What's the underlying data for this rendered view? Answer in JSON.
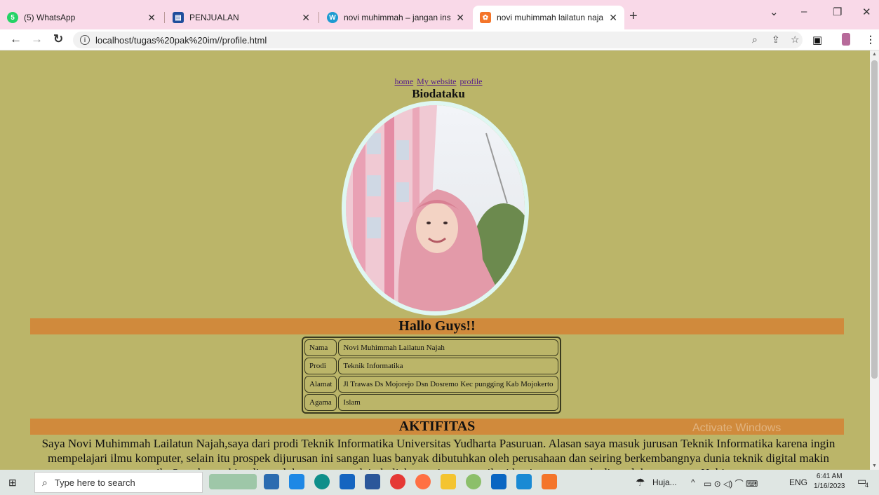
{
  "browser": {
    "tabs": [
      {
        "label": "(5) WhatsApp",
        "color": "#25d366",
        "glyph": "5"
      },
      {
        "label": "PENJUALAN",
        "color": "#1f4e9c",
        "glyph": "▤"
      },
      {
        "label": "novi muhimmah – jangan insecu",
        "color": "#1d9bd1",
        "glyph": "W"
      },
      {
        "label": "novi muhimmah lailatun najah",
        "color": "#f4752a",
        "glyph": "✿"
      }
    ],
    "address": "localhost/tugas%20pak%20im//profile.html"
  },
  "page": {
    "links": [
      "home",
      "My website",
      "profile"
    ],
    "heading": "Biodataku",
    "greeting": "Hallo Guys!!",
    "bio": [
      {
        "label": "Nama",
        "value": "Novi Muhimmah Lailatun Najah"
      },
      {
        "label": "Prodi",
        "value": "Teknik Informatika"
      },
      {
        "label": "Alamat",
        "value": "Jl Trawas Ds Mojorejo Dsn Dosremo Kec pungging Kab Mojokerto"
      },
      {
        "label": "Agama",
        "value": "Islam"
      }
    ],
    "activity_heading": "AKTIFITAS",
    "activity_text": "Saya Novi Muhimmah Lailatun Najah,saya dari prodi Teknik Informatika Universitas Yudharta Pasuruan. Alasan saya masuk jurusan Teknik Informatika karena ingin mempelajari ilmu komputer, selain itu prospek dijurusan ini sangan luas banyak dibutuhkan oleh perusahaan dan seiring berkembangnya dunia teknik digital makin canggih. Saya bermukim di pondok pesantren selain kuliah saya juga mengikuti kegiatan yang ada dipondok pesantren. Hobi saya",
    "watermark": "Activate Windows",
    "bg_color": "#bbb569",
    "band_color": "#d08a3c"
  },
  "taskbar": {
    "search_placeholder": "Type here to search",
    "weather": "Huja...",
    "lang": "ENG",
    "time": "6:41 AM",
    "date": "1/16/2023",
    "notif": "4"
  }
}
